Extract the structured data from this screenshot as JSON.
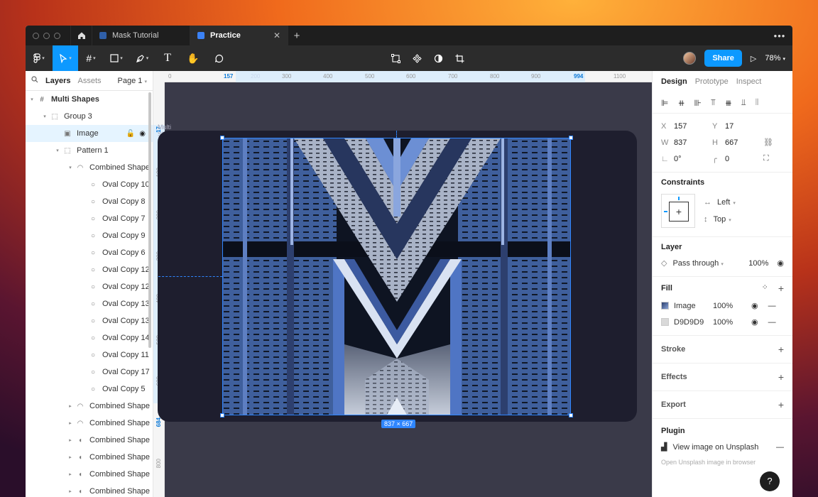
{
  "tabs": [
    {
      "label": "Mask Tutorial",
      "active": false
    },
    {
      "label": "Practice",
      "active": true
    }
  ],
  "toolbar": {
    "share_label": "Share",
    "zoom": "78%"
  },
  "left_panel": {
    "tab_layers": "Layers",
    "tab_assets": "Assets",
    "page": "Page 1",
    "layers": [
      {
        "name": "Multi Shapes",
        "indent": 0,
        "arrow": "▾",
        "icon": "#",
        "bold": true
      },
      {
        "name": "Group 3",
        "indent": 1,
        "arrow": "▾",
        "icon": "⬚"
      },
      {
        "name": "Image",
        "indent": 2,
        "arrow": "",
        "icon": "▣",
        "selected": true
      },
      {
        "name": "Pattern 1",
        "indent": 2,
        "arrow": "▾",
        "icon": "⬚"
      },
      {
        "name": "Combined Shape",
        "indent": 3,
        "arrow": "▾",
        "icon": "◠"
      },
      {
        "name": "Oval Copy 10",
        "indent": 4,
        "arrow": "",
        "icon": "○"
      },
      {
        "name": "Oval Copy 8",
        "indent": 4,
        "arrow": "",
        "icon": "○"
      },
      {
        "name": "Oval Copy 7",
        "indent": 4,
        "arrow": "",
        "icon": "○"
      },
      {
        "name": "Oval Copy 9",
        "indent": 4,
        "arrow": "",
        "icon": "○"
      },
      {
        "name": "Oval Copy 6",
        "indent": 4,
        "arrow": "",
        "icon": "○"
      },
      {
        "name": "Oval Copy 12",
        "indent": 4,
        "arrow": "",
        "icon": "○"
      },
      {
        "name": "Oval Copy 12",
        "indent": 4,
        "arrow": "",
        "icon": "○"
      },
      {
        "name": "Oval Copy 13",
        "indent": 4,
        "arrow": "",
        "icon": "○"
      },
      {
        "name": "Oval Copy 13",
        "indent": 4,
        "arrow": "",
        "icon": "○"
      },
      {
        "name": "Oval Copy 14",
        "indent": 4,
        "arrow": "",
        "icon": "○"
      },
      {
        "name": "Oval Copy 11",
        "indent": 4,
        "arrow": "",
        "icon": "○"
      },
      {
        "name": "Oval Copy 17",
        "indent": 4,
        "arrow": "",
        "icon": "○"
      },
      {
        "name": "Oval Copy 5",
        "indent": 4,
        "arrow": "",
        "icon": "○"
      },
      {
        "name": "Combined Shape",
        "indent": 3,
        "arrow": "▸",
        "icon": "◠"
      },
      {
        "name": "Combined Shape",
        "indent": 3,
        "arrow": "▸",
        "icon": "◠"
      },
      {
        "name": "Combined Shape",
        "indent": 3,
        "arrow": "▸",
        "icon": "◖"
      },
      {
        "name": "Combined Shape",
        "indent": 3,
        "arrow": "▸",
        "icon": "◖"
      },
      {
        "name": "Combined Shape",
        "indent": 3,
        "arrow": "▸",
        "icon": "◖"
      },
      {
        "name": "Combined Shape",
        "indent": 3,
        "arrow": "▸",
        "icon": "◖"
      }
    ]
  },
  "rulers": {
    "top": [
      "0",
      "157",
      "200",
      "300",
      "400",
      "500",
      "600",
      "700",
      "800",
      "900",
      "994",
      "1100"
    ],
    "left": [
      "17",
      "100",
      "200",
      "300",
      "400",
      "500",
      "600",
      "684",
      "800"
    ]
  },
  "canvas": {
    "frame_label": "Multi Shapes",
    "dimensions": "837 × 667"
  },
  "right_panel": {
    "tabs": [
      "Design",
      "Prototype",
      "Inspect"
    ],
    "x": "157",
    "y": "17",
    "w": "837",
    "h": "667",
    "rotation": "0°",
    "radius": "0",
    "constraints_title": "Constraints",
    "constraint_h": "Left",
    "constraint_v": "Top",
    "layer_title": "Layer",
    "blend": "Pass through",
    "opacity": "100%",
    "fill_title": "Fill",
    "fills": [
      {
        "name": "Image",
        "opacity": "100%"
      },
      {
        "name": "D9D9D9",
        "opacity": "100%"
      }
    ],
    "stroke_title": "Stroke",
    "effects_title": "Effects",
    "export_title": "Export",
    "plugin_title": "Plugin",
    "plugin_name": "View image on Unsplash",
    "plugin_sub": "Open Unsplash image in browser",
    "help": "?"
  },
  "colors": {
    "accent": "#0d99ff",
    "canvas_bg": "#3a3a49",
    "frame_bg": "#1e1e2e",
    "selection": "#2f86ff"
  }
}
